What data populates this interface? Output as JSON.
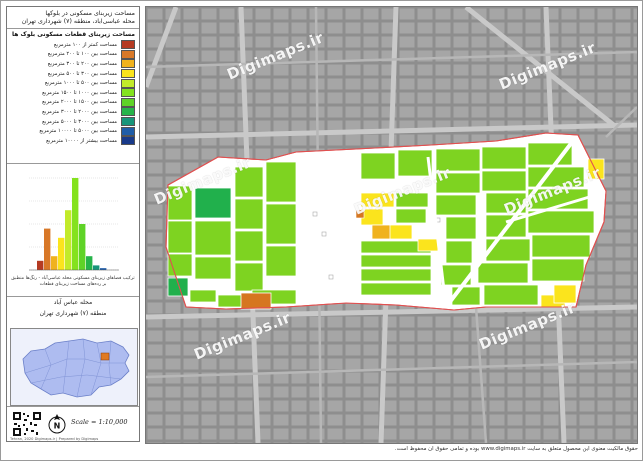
{
  "title": {
    "line1": "مساحت زیربنای مسکونی در بلوکها",
    "line2": "محله عباسی‌آباد، منطقه (۷) شهرداری تهران"
  },
  "legend": {
    "heading": "مساحت زیربنای قطعات مسکونی بلوک ها",
    "items": [
      {
        "label": "مساحت کمتر از ۱۰۰ مترمربع",
        "color": "#b53a22"
      },
      {
        "label": "مساحت بین ۱۰۰ تا ۲۰۰ مترمربع",
        "color": "#d87828"
      },
      {
        "label": "مساحت بین ۲۰۰ تا ۳۰۰ مترمربع",
        "color": "#f0b21e"
      },
      {
        "label": "مساحت بین ۳۰۰ تا ۵۰۰ مترمربع",
        "color": "#fbe41d"
      },
      {
        "label": "مساحت بین ۵۰۰ تا ۱۰۰۰ مترمربع",
        "color": "#c2ea2a"
      },
      {
        "label": "مساحت بین ۱۰۰۰ تا ۱۵۰۰ مترمربع",
        "color": "#84e21e"
      },
      {
        "label": "مساحت بین ۱۵۰۰ تا ۲۰۰۰ مترمربع",
        "color": "#5fd327"
      },
      {
        "label": "مساحت بین ۲۰۰۰ تا ۳۰۰۰ مترمربع",
        "color": "#26b44a"
      },
      {
        "label": "مساحت بین ۳۰۰۰ تا ۵۰۰۰ مترمربع",
        "color": "#17957a"
      },
      {
        "label": "مساحت بین ۵۰۰۰ تا ۱۰۰۰۰ مترمربع",
        "color": "#1f5da8"
      },
      {
        "label": "مساحت بیشتر از ۱۰۰۰۰ مترمربع",
        "color": "#183a8a"
      }
    ]
  },
  "histogram": {
    "caption": "ترکیب فضاهای زیربنای مسکونی محله عباسی‌آباد - رنگ‌ها منطبق بر رده‌های مساحت زیربنای قطعات",
    "bars": [
      {
        "value": 2,
        "color": "#b53a22"
      },
      {
        "value": 9,
        "color": "#d87828"
      },
      {
        "value": 3,
        "color": "#f0b21e"
      },
      {
        "value": 7,
        "color": "#fbe41d"
      },
      {
        "value": 13,
        "color": "#c2ea2a"
      },
      {
        "value": 20,
        "color": "#84e21e"
      },
      {
        "value": 10,
        "color": "#5fd327"
      },
      {
        "value": 3,
        "color": "#26b44a"
      },
      {
        "value": 1,
        "color": "#17957a"
      },
      {
        "value": 0.4,
        "color": "#1f5da8"
      }
    ]
  },
  "area_info": {
    "neighborhood": "محله عباس آباد",
    "district": "منطقه (۷) شهرداری تهران"
  },
  "scale": "Scale = 1:10,000",
  "credit": "Tehran, 2020 Digimaps.ir | Prepared by Digimaps",
  "watermark": "Digimaps.ir",
  "footer_note": "حقوق مالکیت معنوی این محصول متعلق به سایت www.digimaps.ir بوده و تمامی حقوق آن محفوظ است."
}
